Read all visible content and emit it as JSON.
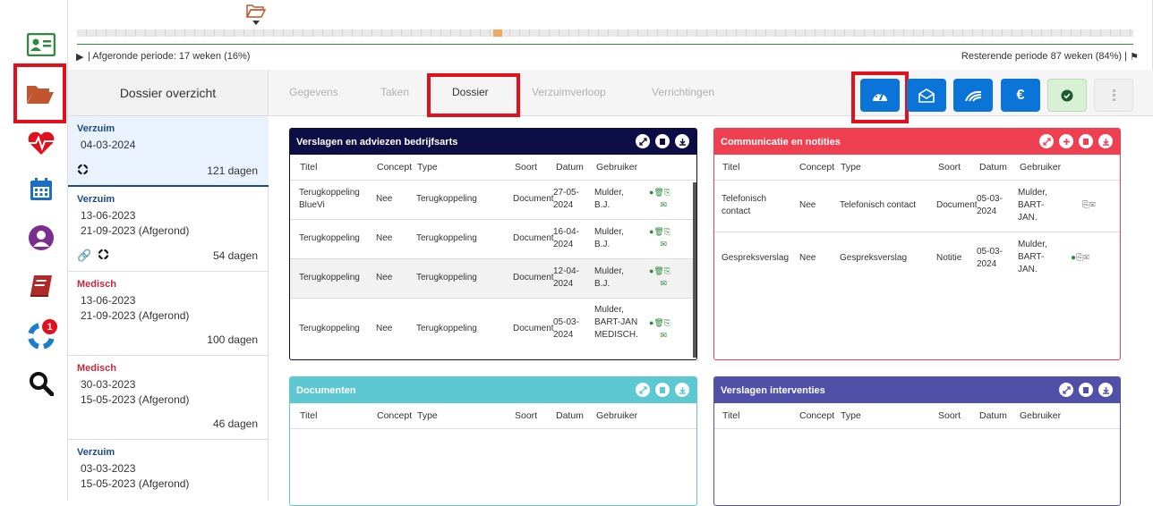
{
  "timeline": {
    "completed_label": "| Afgeronde periode: 17 weken (16%)",
    "remaining_label": "Resterende periode 87 weken (84%) |"
  },
  "rail": {
    "notification_count": "1"
  },
  "dossier_list": {
    "title": "Dossier overzicht",
    "items": [
      {
        "kind": "Verzuim",
        "line1": "04-03-2024",
        "line2": "",
        "days": "121 dagen"
      },
      {
        "kind": "Verzuim",
        "line1": "13-06-2023",
        "line2": "21-09-2023 (Afgerond)",
        "days": "54 dagen"
      },
      {
        "kind": "Medisch",
        "line1": "13-06-2023",
        "line2": "21-09-2023 (Afgerond)",
        "days": "100 dagen"
      },
      {
        "kind": "Medisch",
        "line1": "30-03-2023",
        "line2": "15-05-2023 (Afgerond)",
        "days": "46 dagen"
      },
      {
        "kind": "Verzuim",
        "line1": "03-03-2023",
        "line2": "15-05-2023 (Afgerond)",
        "days": ""
      }
    ]
  },
  "tabs": [
    "Gegevens",
    "Taken",
    "Dossier",
    "Verzuimverloop",
    "Verrichtingen"
  ],
  "action_buttons": {
    "euro_label": "€"
  },
  "columns": {
    "titel": "Titel",
    "concept": "Concept",
    "type": "Type",
    "soort": "Soort",
    "datum": "Datum",
    "gebruiker": "Gebruiker"
  },
  "panels": {
    "bedrijfsarts": {
      "title": "Verslagen en adviezen bedrijfsarts",
      "color": "#0d0d45",
      "rows": [
        {
          "titel": "Terugkoppeling BlueVi",
          "concept": "Nee",
          "type": "Terugkoppeling",
          "soort": "Document",
          "datum": "27-05-2024",
          "gebruiker": "Mulder, B.J."
        },
        {
          "titel": "Terugkoppeling",
          "concept": "Nee",
          "type": "Terugkoppeling",
          "soort": "Document",
          "datum": "16-04-2024",
          "gebruiker": "Mulder, B.J."
        },
        {
          "titel": "Terugkoppeling",
          "concept": "Nee",
          "type": "Terugkoppeling",
          "soort": "Document",
          "datum": "12-04-2024",
          "gebruiker": "Mulder, B.J."
        },
        {
          "titel": "Terugkoppeling",
          "concept": "Nee",
          "type": "Terugkoppeling",
          "soort": "Document",
          "datum": "05-03-2024",
          "gebruiker": "Mulder, BART-JAN MEDISCH."
        }
      ]
    },
    "communicatie": {
      "title": "Communicatie en notities",
      "color": "#ee4050",
      "rows": [
        {
          "titel": "Telefonisch contact",
          "concept": "Nee",
          "type": "Telefonisch contact",
          "soort": "Document",
          "datum": "05-03-2024",
          "gebruiker": "Mulder, BART-JAN."
        },
        {
          "titel": "Gespreksverslag",
          "concept": "Nee",
          "type": "Gespreksverslag",
          "soort": "Notitie",
          "datum": "05-03-2024",
          "gebruiker": "Mulder, BART-JAN."
        }
      ]
    },
    "documenten": {
      "title": "Documenten",
      "color": "#5bc8d2"
    },
    "interventies": {
      "title": "Verslagen interventies",
      "color": "#5050a8"
    }
  }
}
